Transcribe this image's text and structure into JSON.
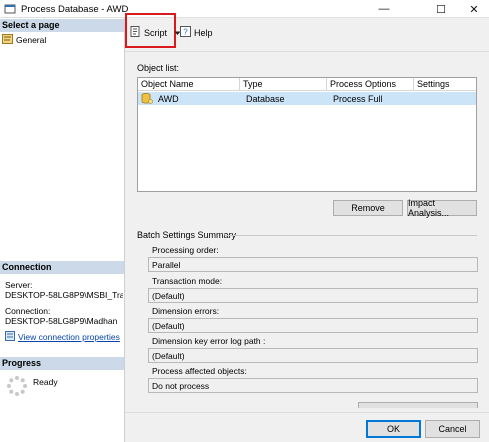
{
  "window": {
    "title": "Process Database - AWD",
    "minimize": "—",
    "maximize": "☐",
    "close": "✕"
  },
  "sidebar": {
    "select_page_header": "Select a page",
    "items": [
      {
        "label": "General"
      }
    ],
    "connection_header": "Connection",
    "server_label": "Server:",
    "server_value": "DESKTOP-58LG8P9\\MSBI_Traini",
    "connection_label": "Connection:",
    "connection_value": "DESKTOP-58LG8P9\\Madhan",
    "view_link": "View connection properties",
    "progress_header": "Progress",
    "progress_status": "Ready"
  },
  "toolbar": {
    "script_label": "Script",
    "help_label": "Help"
  },
  "object_list": {
    "label": "Object list:",
    "columns": [
      "Object Name",
      "Type",
      "Process Options",
      "Settings"
    ],
    "rows": [
      {
        "name": "AWD",
        "type": "Database",
        "process_option": "Process Full",
        "settings": ""
      }
    ]
  },
  "actions": {
    "remove": "Remove",
    "impact": "Impact Analysis..."
  },
  "batch": {
    "title": "Batch Settings Summary",
    "processing_order_label": "Processing order:",
    "processing_order_value": "Parallel",
    "transaction_mode_label": "Transaction mode:",
    "transaction_mode_value": "(Default)",
    "dimension_errors_label": "Dimension errors:",
    "dimension_errors_value": "(Default)",
    "key_error_log_label": "Dimension key error log path :",
    "key_error_log_value": "(Default)",
    "affected_objects_label": "Process affected objects:",
    "affected_objects_value": "Do not process"
  },
  "footer": {
    "ok": "OK",
    "cancel": "Cancel"
  },
  "colors": {
    "section_header": "#ccd9e8",
    "selected_row": "#cce4f7",
    "highlight": "#d9191c",
    "link": "#0645ad"
  }
}
